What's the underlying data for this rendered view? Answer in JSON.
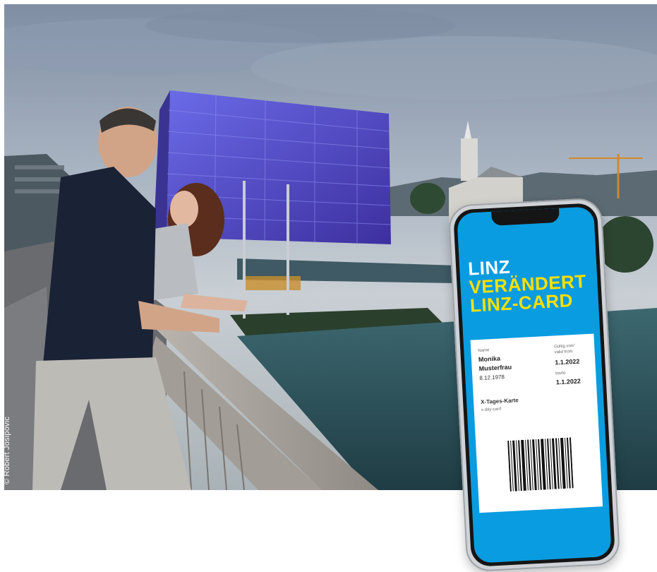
{
  "photo": {
    "credit": "© Robert Josipovic",
    "sky_color": "#aab5c3",
    "water_color": "#355a62",
    "building_color": "#5a4fd0"
  },
  "phone": {
    "screen_color": "#0a9ce0",
    "accent_color": "#ffe000",
    "headline": [
      "LINZ",
      "VERÄNDERT",
      "LINZ-CARD"
    ],
    "ticket": {
      "name_label": "Name",
      "first_name": "Monika",
      "last_name": "Musterfrau",
      "birth_date": "8.12.1978",
      "valid_from_label": [
        "Gültig von/",
        "valid from"
      ],
      "valid_from": "1.1.2022",
      "valid_until_label": "bis/to",
      "valid_until": "1.1.2022",
      "card_type": "X-Tages-Karte",
      "card_type_en": "x-day-card"
    }
  }
}
